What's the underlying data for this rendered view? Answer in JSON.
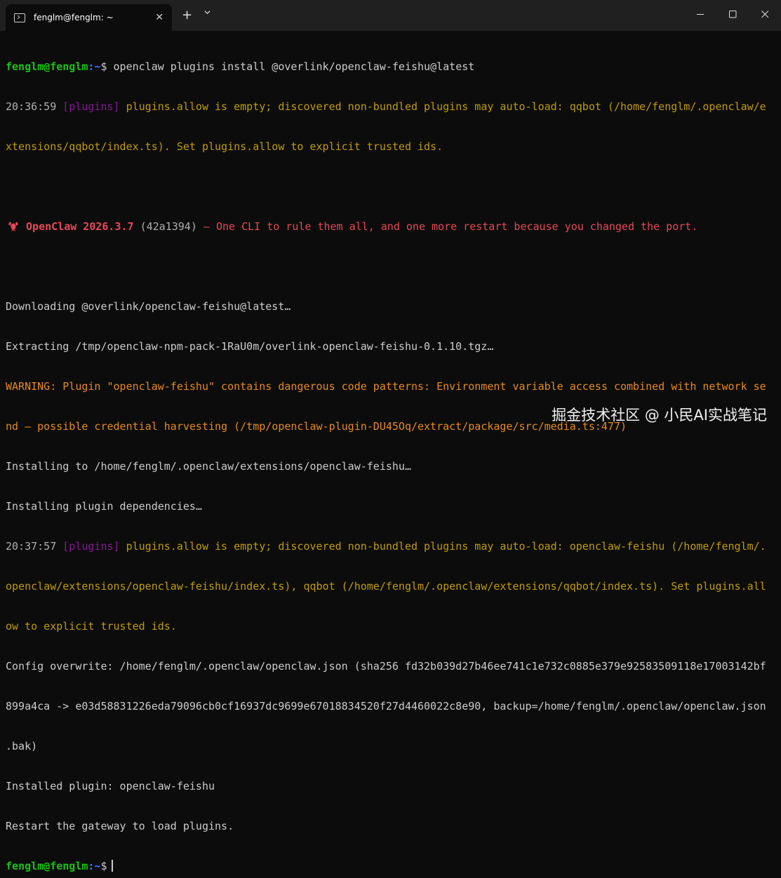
{
  "window": {
    "tab_title": "fenglm@fenglm: ~",
    "tab_close": "✕",
    "new_tab": "+"
  },
  "prompt": {
    "user_host": "fenglm@fenglm",
    "path": ":~",
    "symbol": "$"
  },
  "lines": {
    "l1_cmd": " openclaw plugins install @overlink/openclaw-feishu@latest",
    "l2_time": "20:36:59",
    "l2_tag": " [plugins]",
    "l2_msg": " plugins.allow is empty; discovered non-bundled plugins may auto-load: qqbot (/home/fenglm/.openclaw/e",
    "l3_msg": "xtensions/qqbot/index.ts). Set plugins.allow to explicit trusted ids.",
    "l5_name": " OpenClaw 2026.3.7",
    "l5_hash": " (42a1394)",
    "l5_msg": " — One CLI to rule them all, and one more restart because you changed the port.",
    "l7": "Downloading @overlink/openclaw-feishu@latest…",
    "l8": "Extracting /tmp/openclaw-npm-pack-1RaU0m/overlink-openclaw-feishu-0.1.10.tgz…",
    "l9": "WARNING: Plugin \"openclaw-feishu\" contains dangerous code patterns: Environment variable access combined with network se",
    "l10": "nd — possible credential harvesting (/tmp/openclaw-plugin-DU45Oq/extract/package/src/media.ts:477)",
    "l11": "Installing to /home/fenglm/.openclaw/extensions/openclaw-feishu…",
    "l12": "Installing plugin dependencies…",
    "l13_time": "20:37:57",
    "l13_tag": " [plugins]",
    "l13_msg": " plugins.allow is empty; discovered non-bundled plugins may auto-load: openclaw-feishu (/home/fenglm/.",
    "l14": "openclaw/extensions/openclaw-feishu/index.ts), qqbot (/home/fenglm/.openclaw/extensions/qqbot/index.ts). Set plugins.all",
    "l15": "ow to explicit trusted ids.",
    "l16": "Config overwrite: /home/fenglm/.openclaw/openclaw.json (sha256 fd32b039d27b46ee741c1e732c0885e379e92583509118e17003142bf",
    "l17": "899a4ca -> e03d58831226eda79096cb0cf16937dc9699e67018834520f27d4460022c8e90, backup=/home/fenglm/.openclaw/openclaw.json",
    "l18": ".bak)",
    "l19": "Installed plugin: openclaw-feishu",
    "l20": "Restart the gateway to load plugins."
  },
  "watermark": "掘金技术社区 @ 小民AI实战笔记",
  "colors": {
    "background": "#0c0c0c",
    "titlebar": "#202020",
    "prompt_green": "#16c60c",
    "path_blue": "#3b78ff",
    "tag_purple": "#881798",
    "warn_yellow": "#c19c00",
    "warning_orange": "#e88a1a",
    "claw_red": "#e74856"
  },
  "icons": [
    "terminal-icon",
    "close-icon",
    "plus-icon",
    "chevron-down-icon",
    "minimize-icon",
    "maximize-icon",
    "lobster-icon"
  ]
}
